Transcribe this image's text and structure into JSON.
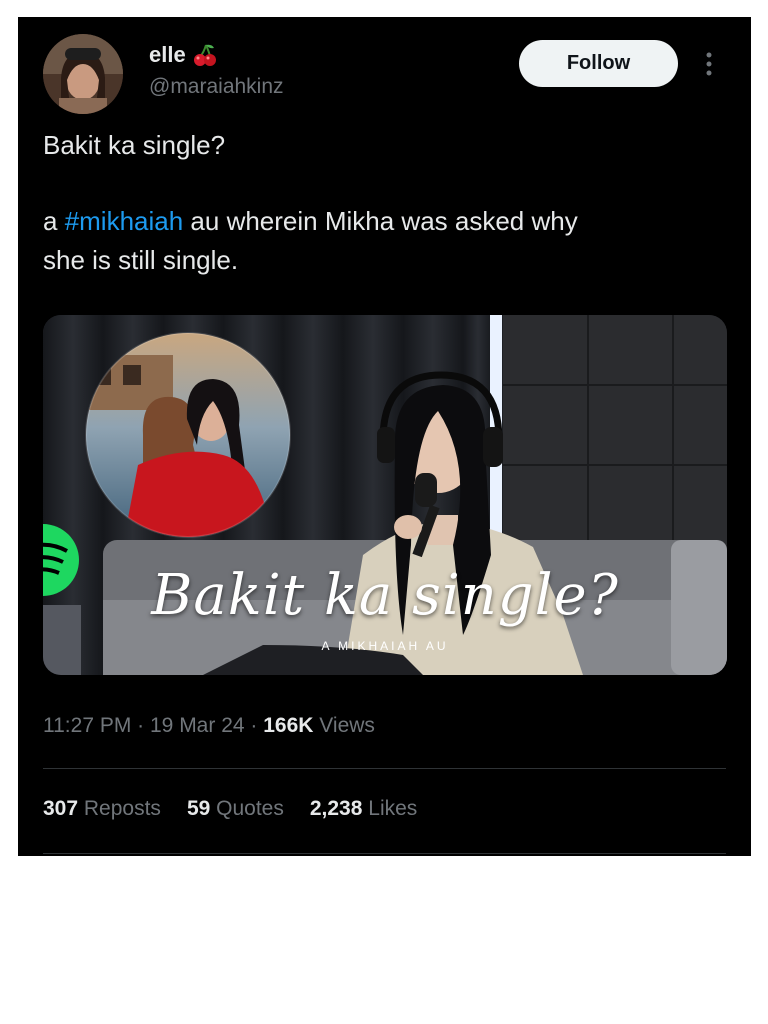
{
  "author": {
    "display_name": "elle",
    "handle": "@maraiahkinz",
    "name_emoji": "cherries-icon"
  },
  "follow_label": "Follow",
  "tweet": {
    "line1": "Bakit ka single?",
    "line2_prefix": "a ",
    "hashtag": "#mikhaiah",
    "line2_suffix": " au wherein Mikha was asked why",
    "line3": "she is still single."
  },
  "media": {
    "overlay_title": "Bakit ka single?",
    "overlay_subtitle": "A MIKHAIAH AU"
  },
  "meta": {
    "time": "11:27 PM",
    "sep1": " · ",
    "date": "19 Mar 24",
    "sep2": " · ",
    "views_count": "166K",
    "views_label": " Views"
  },
  "stats": {
    "reposts_count": "307",
    "reposts_label": "Reposts",
    "quotes_count": "59",
    "quotes_label": "Quotes",
    "likes_count": "2,238",
    "likes_label": "Likes"
  },
  "colors": {
    "background": "#000000",
    "text": "#e7e9ea",
    "secondary_text": "#71767b",
    "hashtag": "#1d9bf0",
    "follow_bg": "#eff3f4"
  }
}
